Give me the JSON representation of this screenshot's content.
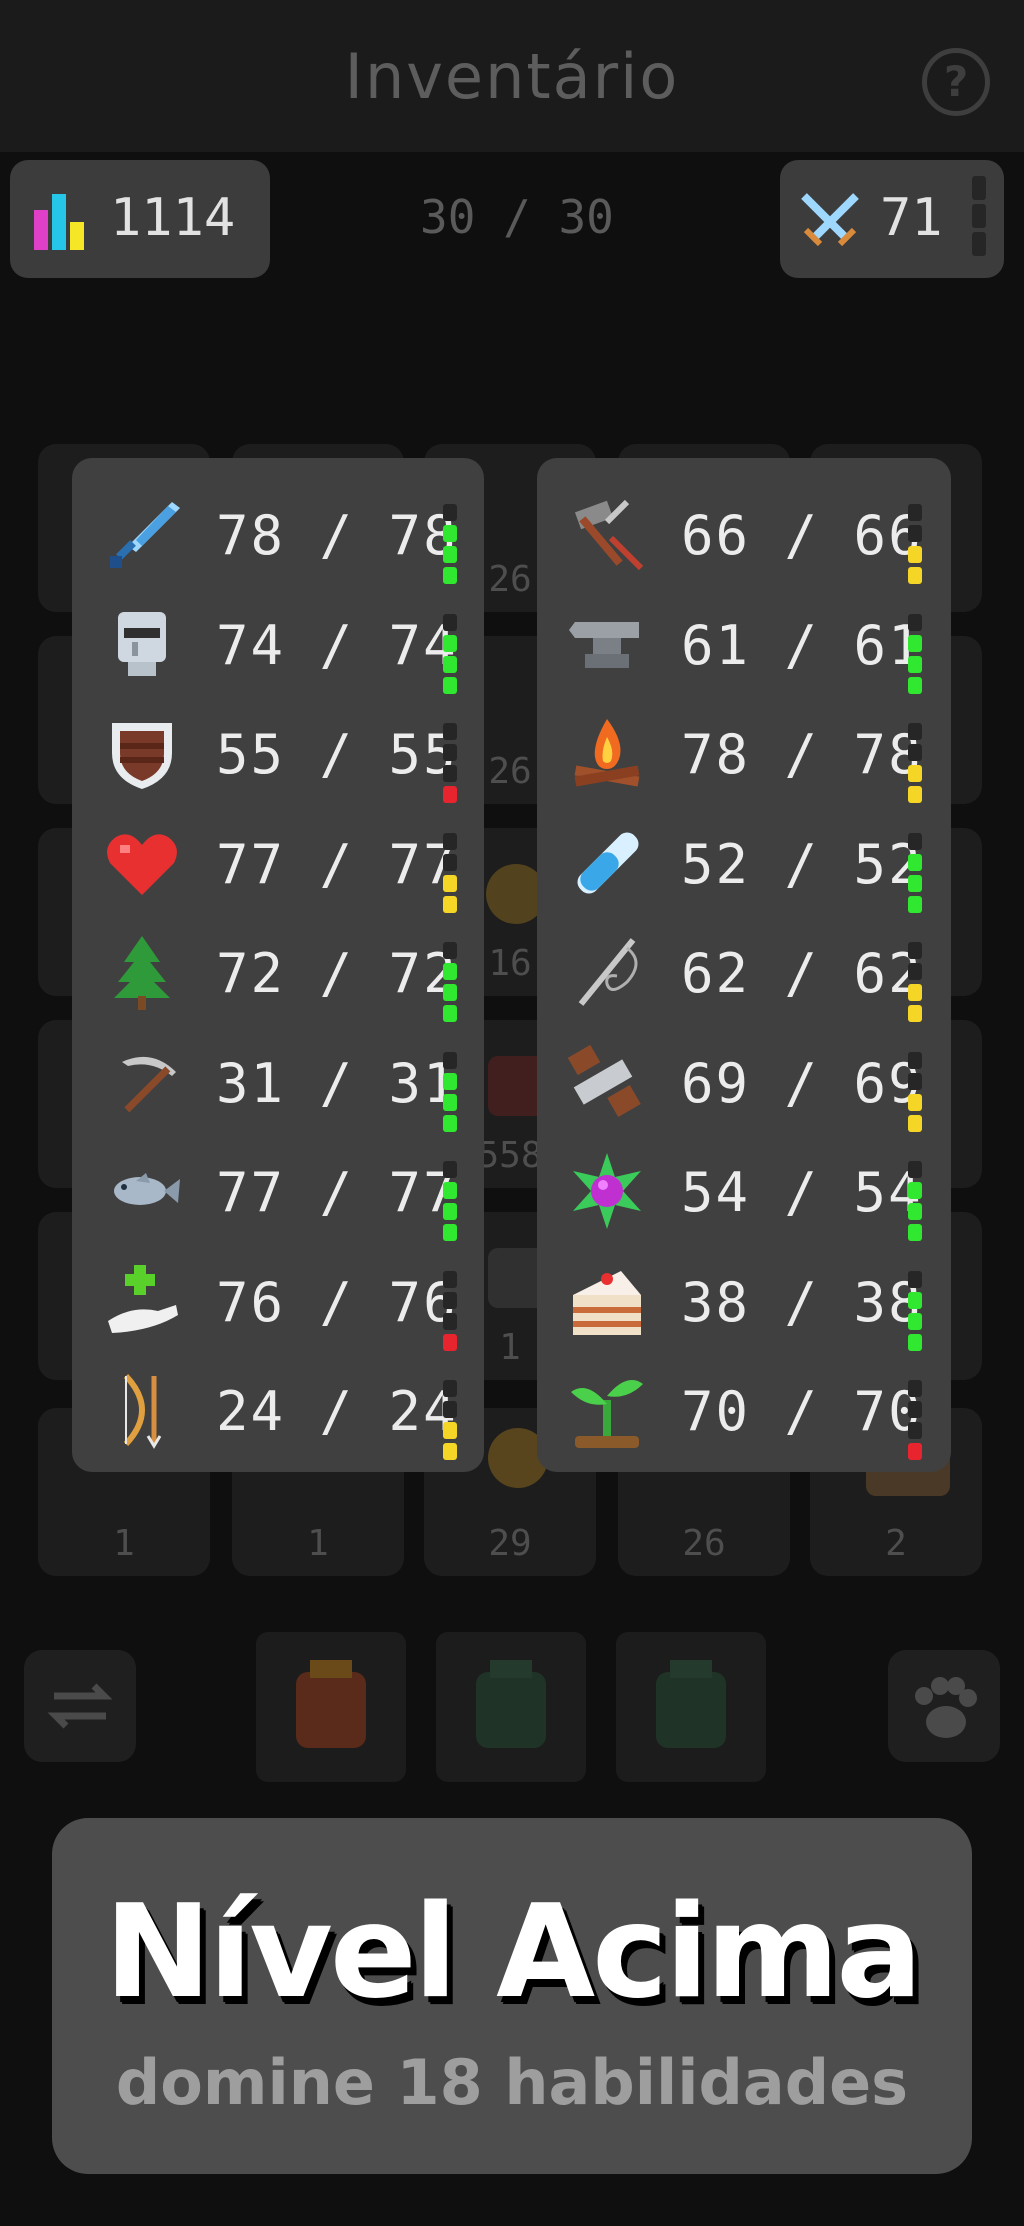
{
  "header": {
    "title": "Inventário",
    "help_icon": "?"
  },
  "stats": {
    "score": "1114",
    "capacity": "30 / 30",
    "combat_level": "71"
  },
  "grid": {
    "counts_visible": [
      "26",
      "26",
      "16",
      "558",
      "1",
      "1",
      "1",
      "29",
      "26",
      "2"
    ]
  },
  "skills_left": [
    {
      "icon": "sword-icon",
      "value": "78 / 78",
      "level": "green"
    },
    {
      "icon": "helmet-icon",
      "value": "74 / 74",
      "level": "green"
    },
    {
      "icon": "shield-icon",
      "value": "55 / 55",
      "level": "red"
    },
    {
      "icon": "heart-icon",
      "value": "77 / 77",
      "level": "yellow"
    },
    {
      "icon": "tree-icon",
      "value": "72 / 72",
      "level": "green"
    },
    {
      "icon": "pickaxe-icon",
      "value": "31 / 31",
      "level": "green"
    },
    {
      "icon": "fish-icon",
      "value": "77 / 77",
      "level": "green"
    },
    {
      "icon": "healing-hand-icon",
      "value": "76 / 76",
      "level": "red"
    },
    {
      "icon": "bow-icon",
      "value": "24 / 24",
      "level": "yellow"
    }
  ],
  "skills_right": [
    {
      "icon": "hammer-icon",
      "value": "66 / 66",
      "level": "yellow"
    },
    {
      "icon": "anvil-icon",
      "value": "61 / 61",
      "level": "green"
    },
    {
      "icon": "campfire-icon",
      "value": "78 / 78",
      "level": "yellow"
    },
    {
      "icon": "vial-icon",
      "value": "52 / 52",
      "level": "green"
    },
    {
      "icon": "needle-icon",
      "value": "62 / 62",
      "level": "yellow"
    },
    {
      "icon": "saw-icon",
      "value": "69 / 69",
      "level": "yellow"
    },
    {
      "icon": "gem-icon",
      "value": "54 / 54",
      "level": "green"
    },
    {
      "icon": "cake-icon",
      "value": "38 / 38",
      "level": "green"
    },
    {
      "icon": "sprout-icon",
      "value": "70 / 70",
      "level": "red"
    }
  ],
  "colors": {
    "green": "#2fe82f",
    "yellow": "#f5d626",
    "red": "#e8242f",
    "panel": "#404040"
  },
  "promo": {
    "title": "Nível Acima",
    "subtitle": "domine 18 habilidades"
  }
}
